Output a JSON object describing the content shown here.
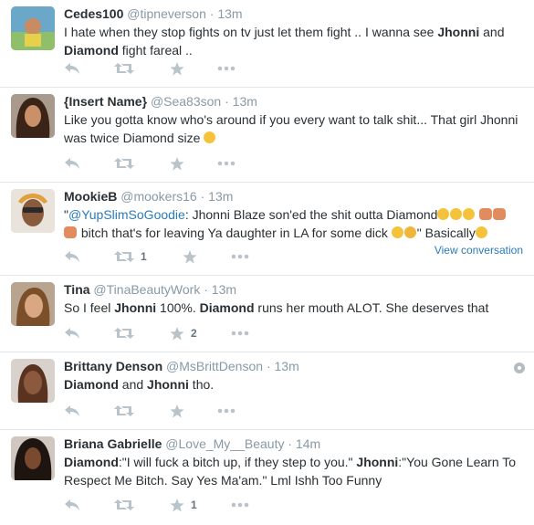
{
  "icon_color": "#b8c3ca",
  "tweets": [
    {
      "name": "Cedes100",
      "handle": "@tipneverson",
      "dot": "·",
      "time": "13m",
      "avatar_icon": "avatar-photo",
      "text": {
        "p1": "I hate when they stop fights on tv just let them fight .. I wanna see ",
        "b1": "Jhonni",
        "p2": " and ",
        "b2": "Diamond",
        "p3": " fight fareal .."
      }
    },
    {
      "name": "{Insert Name}",
      "handle": "@Sea83son",
      "dot": "·",
      "time": "13m",
      "avatar_icon": "avatar-photo",
      "text": {
        "p1": "Like you gotta know who's around if you every want to talk shit... That girl Jhonni was twice Diamond size ",
        "emoji": "relieved-face-emoji"
      }
    },
    {
      "name": "MookieB",
      "handle": "@mookers16",
      "dot": "·",
      "time": "13m",
      "avatar_icon": "avatar-photo",
      "view_conversation": "View conversation",
      "retweet_count": "1",
      "text": {
        "p1": "\"",
        "mention": "@YupSlimSoGoodie",
        "p2": ": Jhonni Blaze son'ed the shit outta Diamond",
        "p3": " bitch that's for leaving Ya daughter in LA for some dick ",
        "p4": "\" Basically",
        "emoji_names": [
          "joy-emoji",
          "fist-emoji",
          "sweat-emoji"
        ]
      }
    },
    {
      "name": "Tina",
      "handle": "@TinaBeautyWork",
      "dot": "·",
      "time": "13m",
      "avatar_icon": "avatar-photo",
      "favorite_count": "2",
      "text": {
        "p1": "So I feel ",
        "b1": "Jhonni",
        "p2": " 100%. ",
        "b2": "Diamond",
        "p3": " runs her mouth ALOT. She deserves that"
      }
    },
    {
      "name": "Brittany Denson",
      "handle": "@MsBrittDenson",
      "dot": "·",
      "time": "13m",
      "avatar_icon": "avatar-photo",
      "text": {
        "b1": "Diamond",
        "p1": " and ",
        "b2": "Jhonni",
        "p2": " tho."
      }
    },
    {
      "name": "Briana Gabrielle",
      "handle": "@Love_My__Beauty",
      "dot": "·",
      "time": "14m",
      "avatar_icon": "avatar-photo",
      "favorite_count": "1",
      "text": {
        "b1": "Diamond",
        "p1": ":\"I will fuck a bitch up, if they step to you.\" ",
        "b2": "Jhonni",
        "p2": ":\"You Gone Learn To Respect Me Bitch. Say Yes Ma'am.\" Lml Ishh Too Funny"
      }
    }
  ]
}
